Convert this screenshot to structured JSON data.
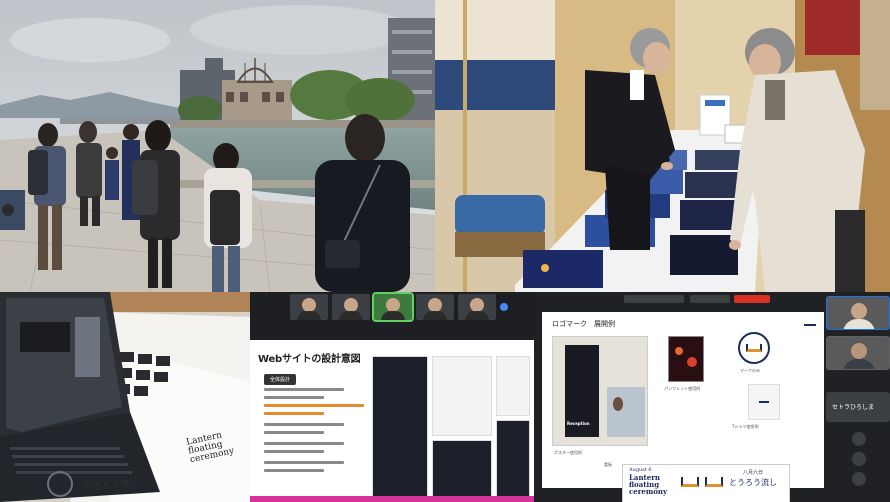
{
  "panels": {
    "hiroshima": {
      "scene": "atomic-bomb-dome-riverside"
    },
    "exhibit": {
      "scene": "poster-exhibition-table"
    },
    "laptop": {
      "paper_text": {
        "brand_line1": "Lantern",
        "brand_line2": "floating",
        "brand_line3": "ceremony",
        "kana": "とうろう流し"
      }
    },
    "meeting1": {
      "slide_title": "Webサイトの設計意図",
      "section_tag": "全体設計"
    },
    "meeting2": {
      "slide_title": "ロゴマーク　展開例",
      "labels": {
        "poster": "ポスター使用例",
        "pamphlet": "パンフレット使用例",
        "mark_only": "マークのみ",
        "tshirt": "Tシャツ使用例",
        "signage": "看板"
      },
      "poster_word": "Reception",
      "panel": {
        "date": "August 6",
        "brand_line1": "Lantern",
        "brand_line2": "floating",
        "brand_line3": "ceremony",
        "right_top": "八月六日",
        "right_main": "とうろう流し"
      },
      "participant_name": "セトラひろしま"
    }
  },
  "colors": {
    "accent_pink": "#d6339b",
    "accent_orange": "#e08b2c",
    "meet_blue": "#1a73e8",
    "meet_red": "#d93025",
    "navy": "#1d2a5b"
  }
}
